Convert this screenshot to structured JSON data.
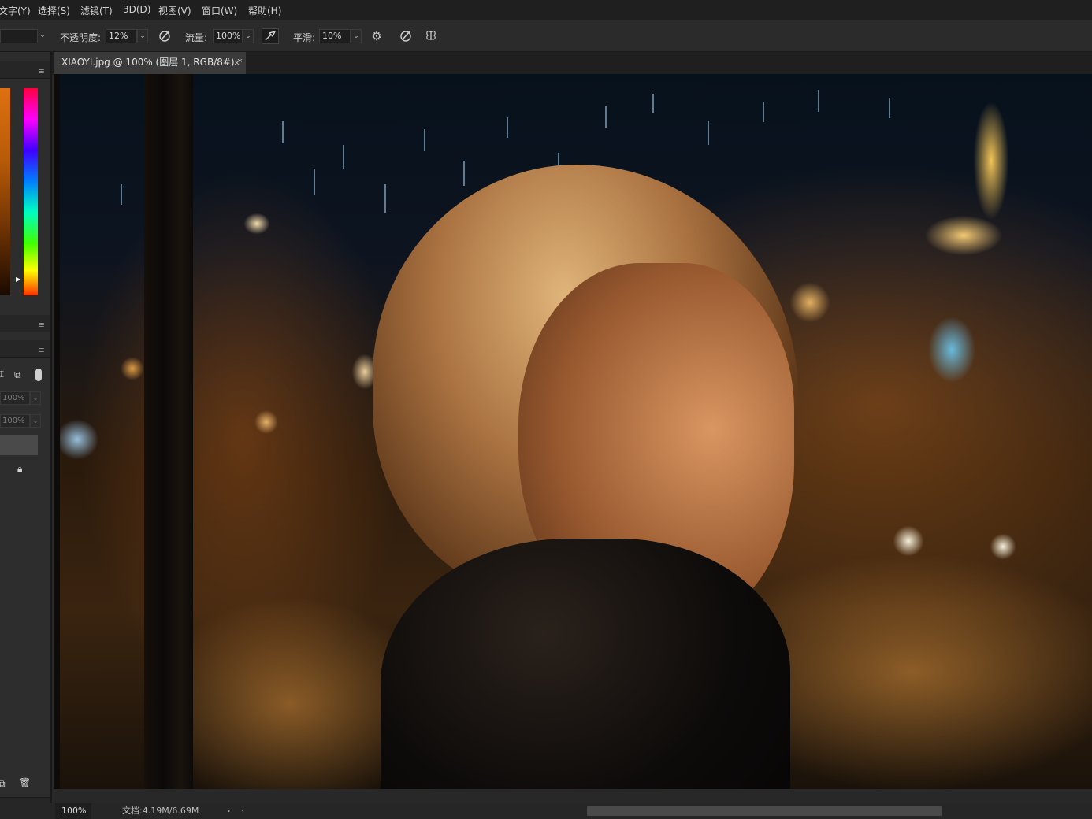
{
  "menubar": {
    "items": [
      "文字(Y)",
      "选择(S)",
      "滤镜(T)",
      "3D(D)",
      "视图(V)",
      "窗口(W)",
      "帮助(H)"
    ]
  },
  "options": {
    "opacity_label": "不透明度:",
    "opacity_value": "12%",
    "flow_label": "流量:",
    "flow_value": "100%",
    "smoothing_label": "平滑:",
    "smoothing_value": "10%",
    "icons": [
      "pressure-opacity-icon",
      "airbrush-icon",
      "gear-icon",
      "pressure-size-icon",
      "symmetry-icon"
    ]
  },
  "document": {
    "tab_title": "XIAOYI.jpg @ 100% (图层 1, RGB/8#) *",
    "close_glyph": "×"
  },
  "left_panel": {
    "layer_opacity": "100%",
    "layer_fill": "100%"
  },
  "status": {
    "zoom": "100%",
    "doc_info": "文档:4.19M/6.69M",
    "arrow": "›",
    "left_arrow": "‹"
  },
  "colors": {
    "menubar_bg": "#1f1f1f",
    "panel_bg": "#2d2d2d",
    "canvas_frame": "#282828"
  }
}
